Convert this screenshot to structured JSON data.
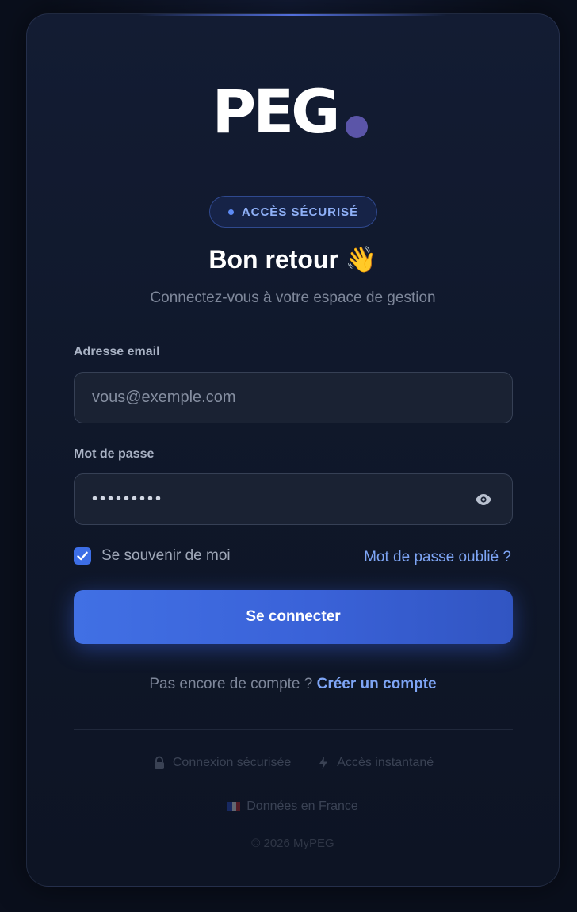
{
  "brand": {
    "logo_text": "PEG"
  },
  "badge": {
    "label": "ACCÈS SÉCURISÉ"
  },
  "header": {
    "title": "Bon retour 👋",
    "subtitle": "Connectez-vous à votre espace de gestion"
  },
  "form": {
    "email_label": "Adresse email",
    "email_placeholder": "vous@exemple.com",
    "password_label": "Mot de passe",
    "password_value": "•••••••••",
    "remember_label": "Se souvenir de moi",
    "remember_checked": true,
    "forgot_link": "Mot de passe oublié ?",
    "submit_label": "Se connecter"
  },
  "signup": {
    "prompt": "Pas encore de compte ? ",
    "link": "Créer un compte"
  },
  "footer": {
    "features": [
      "Connexion sécurisée",
      "Accès instantané",
      "Données en France"
    ],
    "copyright": "© 2026 MyPEG"
  },
  "colors": {
    "accent": "#3d6ee6",
    "link": "#7ea5f5",
    "card_bg": "#111a2e",
    "page_bg": "#0a0f1c"
  },
  "icons": {
    "feature_0": "lock-icon",
    "feature_1": "bolt-icon",
    "feature_2": "flag-fr-icon",
    "password_toggle": "eye-icon",
    "remember": "check-icon"
  }
}
